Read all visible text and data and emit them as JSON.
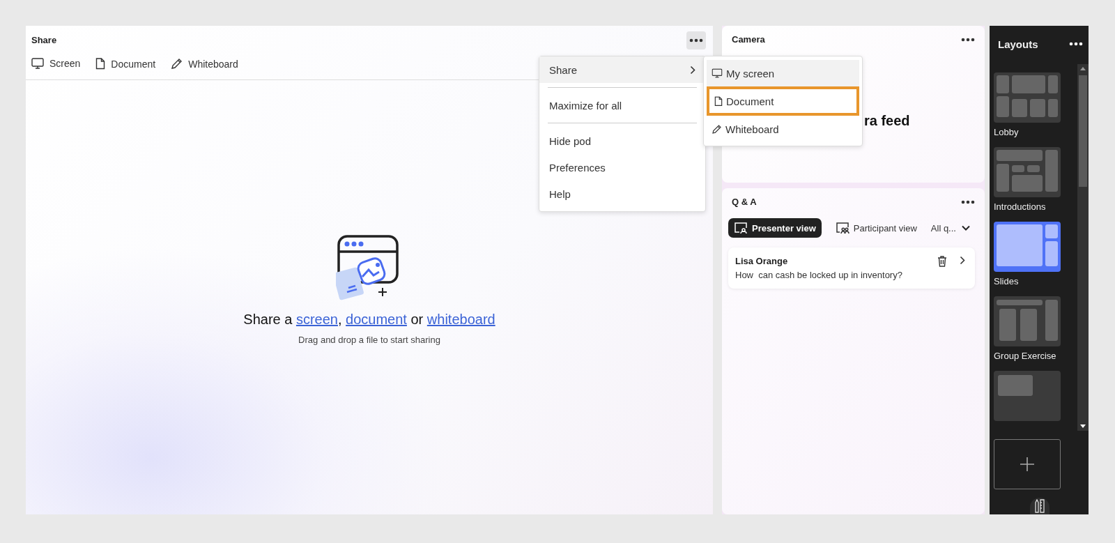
{
  "share_pod": {
    "title": "Share",
    "tabs": [
      {
        "label": "Screen",
        "kind": "screen"
      },
      {
        "label": "Document",
        "kind": "document"
      },
      {
        "label": "Whiteboard",
        "kind": "whiteboard"
      }
    ],
    "headline": [
      {
        "kind": "text",
        "text": "Share a "
      },
      {
        "kind": "link",
        "text": "screen"
      },
      {
        "kind": "text",
        "text": ", "
      },
      {
        "kind": "link",
        "text": "document"
      },
      {
        "kind": "text",
        "text": " or "
      },
      {
        "kind": "link",
        "text": "whiteboard"
      }
    ],
    "hint": "Drag and drop a file to start sharing"
  },
  "pod_menu": {
    "items": [
      {
        "kind": "submenu",
        "label": "Share",
        "hovered": true
      },
      {
        "kind": "divider"
      },
      {
        "kind": "item",
        "label": "Maximize for all",
        "hovered": false
      },
      {
        "kind": "divider"
      },
      {
        "kind": "item",
        "label": "Hide pod",
        "hovered": false
      },
      {
        "kind": "item",
        "label": "Preferences",
        "hovered": false
      },
      {
        "kind": "item",
        "label": "Help",
        "hovered": false
      }
    ],
    "submenu": [
      {
        "kind": "screen",
        "label": "My screen",
        "hovered": true,
        "outlined": false
      },
      {
        "kind": "document",
        "label": "Document",
        "hovered": false,
        "outlined": true
      },
      {
        "kind": "whiteboard",
        "label": "Whiteboard",
        "hovered": false,
        "outlined": false
      }
    ]
  },
  "camera_pod": {
    "title": "Camera",
    "message": "ra feed"
  },
  "qa_pod": {
    "title": "Q & A",
    "views": [
      {
        "label": "Presenter view",
        "kind": "presenter",
        "selected": true
      },
      {
        "label": "Participant view",
        "kind": "participant",
        "selected": false
      }
    ],
    "filter": "All q...",
    "questions": [
      {
        "author": "Lisa Orange",
        "text": "How  can cash be locked up in inventory?"
      }
    ]
  },
  "layouts": {
    "title": "Layouts",
    "items": [
      {
        "label": "Lobby",
        "kind": "lobby",
        "selected": false
      },
      {
        "label": "Introductions",
        "kind": "introductions",
        "selected": false
      },
      {
        "label": "Slides",
        "kind": "slides",
        "selected": true
      },
      {
        "label": "Group Exercise",
        "kind": "group",
        "selected": false
      },
      {
        "kind": "spotlight",
        "selected": false
      }
    ]
  }
}
